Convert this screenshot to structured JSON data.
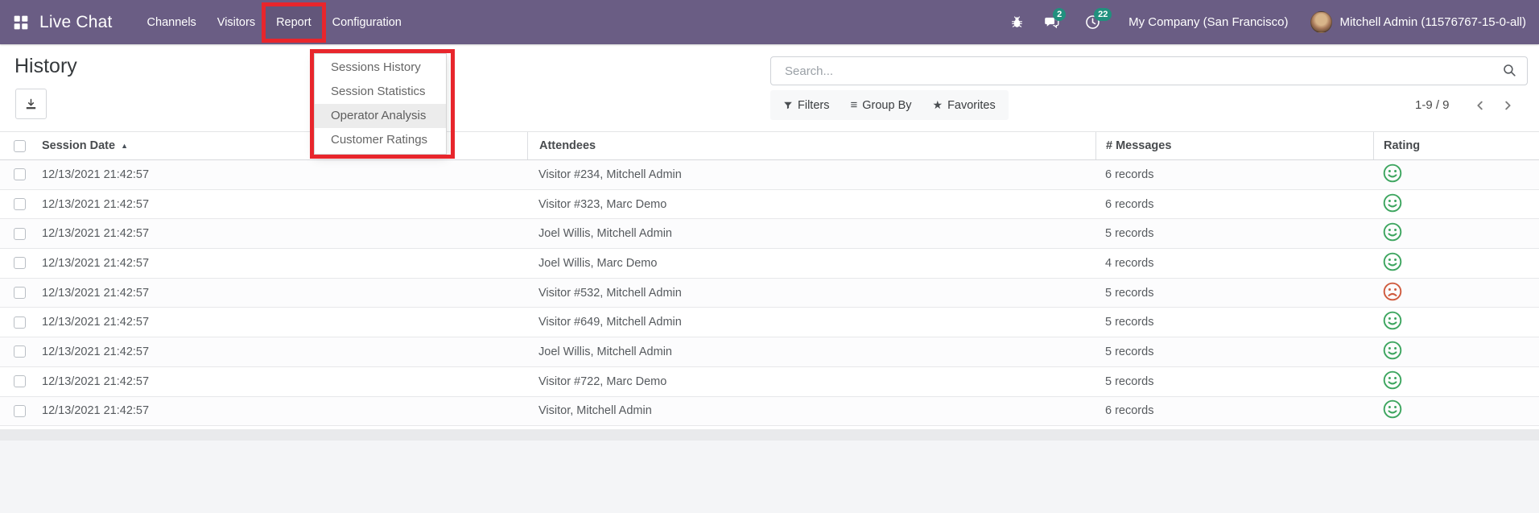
{
  "colors": {
    "navbar_bg": "#6a5d84",
    "badge": "#21907e",
    "annotation_red": "#e8262c",
    "rating_happy": "#3da55f",
    "rating_sad": "#cf5b3e"
  },
  "navbar": {
    "app_name": "Live Chat",
    "items": [
      {
        "label": "Channels"
      },
      {
        "label": "Visitors"
      },
      {
        "label": "Report"
      },
      {
        "label": "Configuration"
      }
    ],
    "messages_badge": "2",
    "activities_badge": "22",
    "company": "My Company (San Francisco)",
    "user": "Mitchell Admin (11576767-15-0-all)"
  },
  "page": {
    "title": "History"
  },
  "report_menu": {
    "items": [
      {
        "label": "Sessions History",
        "css": "dd-item"
      },
      {
        "label": "Session Statistics",
        "css": "dd-item"
      },
      {
        "label": "Operator Analysis",
        "css": "dd-item active"
      },
      {
        "label": "Customer Ratings",
        "css": "dd-item"
      }
    ]
  },
  "search": {
    "placeholder": "Search..."
  },
  "controls": {
    "filters": "Filters",
    "group_by": "Group By",
    "favorites": "Favorites"
  },
  "pagination": {
    "range": "1-9 / 9"
  },
  "icons": {
    "sort_asc": "▲",
    "group_by": "≡",
    "favorites": "★"
  },
  "table": {
    "headers": {
      "date": "Session Date",
      "attendees": "Attendees",
      "messages": "# Messages",
      "rating": "Rating"
    },
    "sort": "Session Date ascending",
    "rows": [
      {
        "date": "12/13/2021 21:42:57",
        "attendees": "Visitor #234, Mitchell Admin",
        "messages": "6 records",
        "rating": "happy",
        "css": "face happy"
      },
      {
        "date": "12/13/2021 21:42:57",
        "attendees": "Visitor #323, Marc Demo",
        "messages": "6 records",
        "rating": "happy",
        "css": "face happy"
      },
      {
        "date": "12/13/2021 21:42:57",
        "attendees": "Joel Willis, Mitchell Admin",
        "messages": "5 records",
        "rating": "happy",
        "css": "face happy"
      },
      {
        "date": "12/13/2021 21:42:57",
        "attendees": "Joel Willis, Marc Demo",
        "messages": "4 records",
        "rating": "happy",
        "css": "face happy"
      },
      {
        "date": "12/13/2021 21:42:57",
        "attendees": "Visitor #532, Mitchell Admin",
        "messages": "5 records",
        "rating": "sad",
        "css": "face sad"
      },
      {
        "date": "12/13/2021 21:42:57",
        "attendees": "Visitor #649, Mitchell Admin",
        "messages": "5 records",
        "rating": "happy",
        "css": "face happy"
      },
      {
        "date": "12/13/2021 21:42:57",
        "attendees": "Joel Willis, Mitchell Admin",
        "messages": "5 records",
        "rating": "happy",
        "css": "face happy"
      },
      {
        "date": "12/13/2021 21:42:57",
        "attendees": "Visitor #722, Marc Demo",
        "messages": "5 records",
        "rating": "happy",
        "css": "face happy"
      },
      {
        "date": "12/13/2021 21:42:57",
        "attendees": "Visitor, Mitchell Admin",
        "messages": "6 records",
        "rating": "happy",
        "css": "face happy"
      }
    ]
  }
}
